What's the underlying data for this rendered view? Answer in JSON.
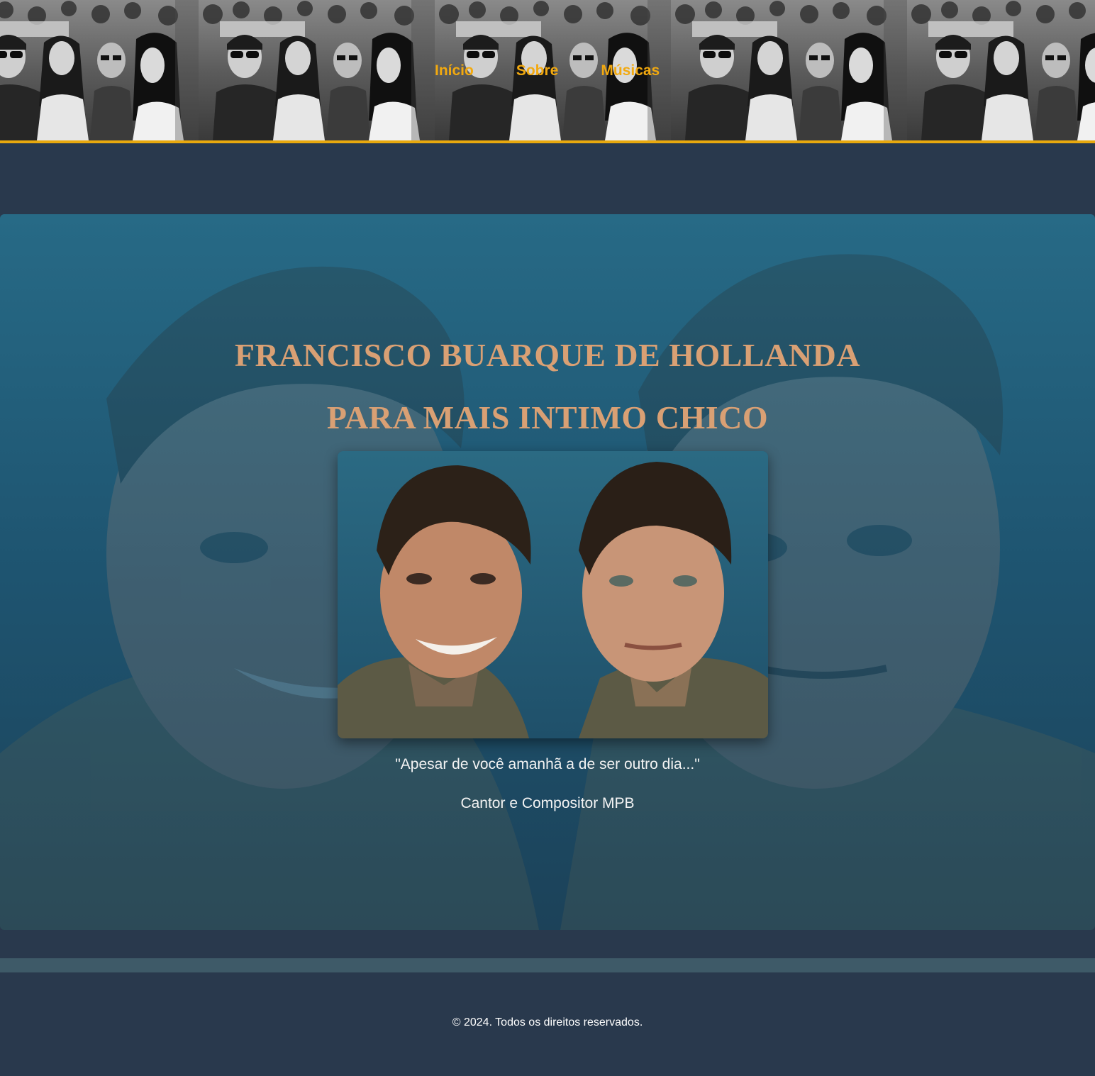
{
  "nav": {
    "items": [
      {
        "label": "Início"
      },
      {
        "label": "Sobre"
      },
      {
        "label": "Músicas"
      }
    ]
  },
  "hero": {
    "title_line1": "FRANCISCO BUARQUE DE HOLLANDA",
    "title_line2": "PARA MAIS INTIMO CHICO",
    "quote": "\"Apesar de você amanhã a de ser outro dia...\"",
    "subtitle": "Cantor e Compositor MPB"
  },
  "footer": {
    "copyright": "© 2024. Todos os direitos reservados."
  },
  "colors": {
    "nav_link": "#f2a90f",
    "header_border": "#e8a90e",
    "title": "#d9a074",
    "page_bg": "#29394d",
    "divider": "#3e5a68"
  },
  "images": {
    "header_background": "black-and-white crowd photo tile, repeated",
    "hero_background": "faded double portrait of young man",
    "portrait": "two color portraits of a young man, smiling and serious"
  }
}
